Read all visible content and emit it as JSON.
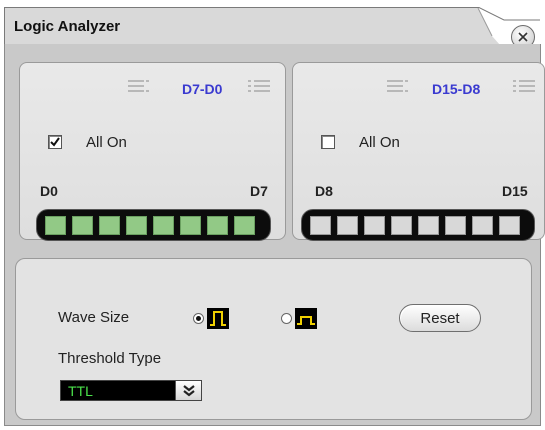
{
  "window": {
    "title": "Logic Analyzer"
  },
  "channels_low": {
    "range_label": "D7-D0",
    "all_on_label": "All On",
    "all_on_checked": true,
    "start_label": "D0",
    "end_label": "D7",
    "leds": [
      "on",
      "on",
      "on",
      "on",
      "on",
      "on",
      "on",
      "on"
    ]
  },
  "channels_high": {
    "range_label": "D15-D8",
    "all_on_label": "All On",
    "all_on_checked": false,
    "start_label": "D8",
    "end_label": "D15",
    "leds": [
      "off",
      "off",
      "off",
      "off",
      "off",
      "off",
      "off",
      "off"
    ]
  },
  "options": {
    "wave_size_label": "Wave Size",
    "wave_size_selected": "large",
    "reset_label": "Reset",
    "threshold_label": "Threshold Type",
    "threshold_value": "TTL"
  },
  "colors": {
    "range_label": "#3a3ad0",
    "led_on": "#92c986",
    "led_off": "#d8d8d8",
    "wave_icon": "#f0d000",
    "threshold_text": "#4be34b"
  }
}
